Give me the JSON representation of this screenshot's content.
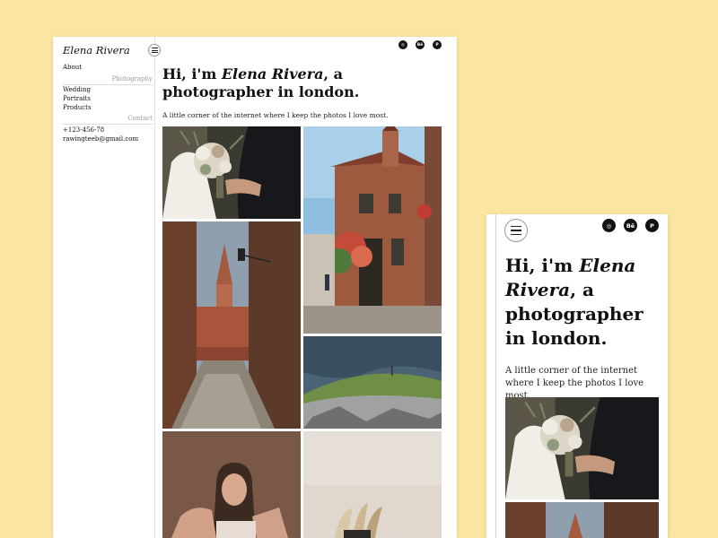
{
  "site": {
    "brand": "Elena Rivera",
    "nav": {
      "about": "About",
      "photography_heading": "Photography",
      "photography_items": [
        "Wedding",
        "Portraits",
        "Products"
      ],
      "contact_heading": "Contact",
      "phone": "+123-456-78",
      "email": "rawingteeb@gmail.com"
    },
    "social": [
      {
        "icon": "instagram-icon",
        "label": "◎"
      },
      {
        "icon": "behance-icon",
        "label": "Bē"
      },
      {
        "icon": "pinterest-icon",
        "label": "P"
      }
    ],
    "hero": {
      "prefix": "Hi, i'm ",
      "name": "Elena Rivera",
      "suffix": ", a photographer in london."
    },
    "tagline": "A little corner of the internet where I keep the photos I love most."
  },
  "colors": {
    "background": "#fae6a0",
    "page": "#ffffff",
    "text": "#111111",
    "muted": "#9a9a9a"
  },
  "gallery": [
    {
      "id": "wedding-bouquet"
    },
    {
      "id": "brick-house-street"
    },
    {
      "id": "church-alley"
    },
    {
      "id": "coastal-cliff"
    },
    {
      "id": "woman-portrait"
    },
    {
      "id": "dried-flowers-vase"
    }
  ]
}
